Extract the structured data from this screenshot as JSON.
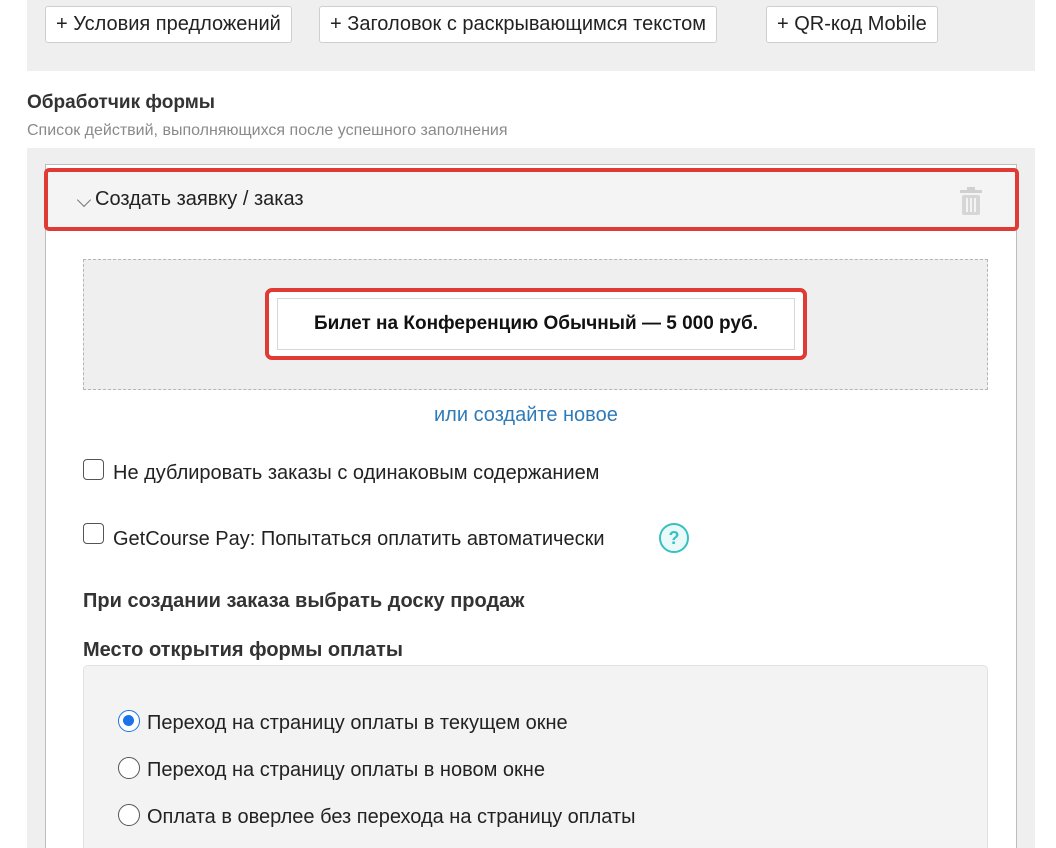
{
  "toolbar": {
    "buttons": [
      "+ Условия предложений",
      "+ Заголовок с раскрывающимся текстом",
      "+ QR-код Mobile"
    ]
  },
  "handler": {
    "title": "Обработчик формы",
    "subtitle": "Список действий, выполняющихся после успешного заполнения"
  },
  "action": {
    "title": "Создать заявку / заказ",
    "chevron_icon": "chevron-down-icon",
    "delete_icon": "trash-icon",
    "offer_label": "Билет на Конференцию Обычный — 5 000 руб.",
    "create_new_link": "или создайте новое",
    "checkboxes": [
      {
        "label": "Не дублировать заказы с одинаковым содержанием",
        "checked": false
      },
      {
        "label": "GetCourse Pay: Попытаться оплатить автоматически",
        "checked": false
      }
    ],
    "help_icon_text": "?",
    "sales_board_heading": "При создании заказа выбрать доску продаж",
    "payment_form_heading": "Место открытия формы оплаты",
    "payment_options": [
      {
        "label": "Переход на страницу оплаты в текущем окне",
        "selected": true
      },
      {
        "label": "Переход на страницу оплаты в новом окне",
        "selected": false
      },
      {
        "label": "Оплата в оверлее без перехода на страницу оплаты",
        "selected": false
      }
    ]
  },
  "colors": {
    "highlight": "#e03a34",
    "link": "#2f7ab8",
    "help": "#39c0c0",
    "radio_selected": "#1a73e8"
  }
}
